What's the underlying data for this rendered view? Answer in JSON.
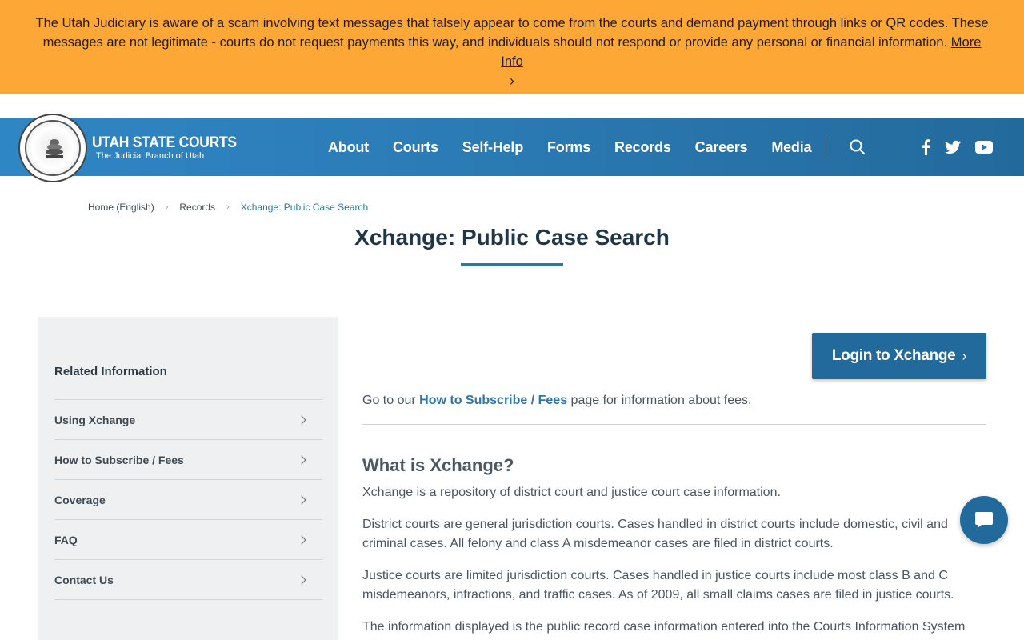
{
  "alert": {
    "message": "The Utah Judiciary is aware of a scam involving text messages that falsely appear to come from the courts and demand payment through links or QR codes. These messages are not legitimate - courts do not request payments this way, and individuals should not respond or provide any personal or financial information.",
    "link_label": "More Info",
    "chevron": "›",
    "background": "#fda836"
  },
  "header": {
    "brand_title": "UTAH STATE COURTS",
    "brand_subtitle": "The Judicial Branch of Utah",
    "nav": [
      "About",
      "Courts",
      "Self-Help",
      "Forms",
      "Records",
      "Careers",
      "Media"
    ],
    "icons": [
      "search-icon",
      "facebook-icon",
      "twitter-icon",
      "youtube-icon"
    ]
  },
  "breadcrumb": {
    "items": [
      "Home (English)",
      "Records",
      "Xchange: Public Case Search"
    ],
    "separator": "›"
  },
  "page": {
    "title": "Xchange: Public Case Search"
  },
  "sidebar": {
    "heading": "Related Information",
    "items": [
      "Using Xchange",
      "How to Subscribe / Fees",
      "Coverage",
      "FAQ",
      "Contact Us"
    ]
  },
  "main": {
    "login_button": "Login to Xchange",
    "login_chevron": "›",
    "intro_prefix": "Go to our ",
    "intro_link": "How to Subscribe / Fees",
    "intro_suffix": " page for information about fees.",
    "section_heading": "What is Xchange?",
    "paragraphs": [
      "Xchange is a repository of district court and justice court case information.",
      "District courts are general jurisdiction courts. Cases handled in district courts include domestic, civil and criminal cases. All felony and class A misdemeanor cases are filed in district courts.",
      "Justice courts are limited jurisdiction courts. Cases handled in justice courts include most class B and C misdemeanors, infractions, and traffic cases. As of 2009, all small claims cases are filed in justice courts.",
      "The information displayed is the public record case information entered into the Courts Information System"
    ]
  },
  "colors": {
    "primary": "#236a9c",
    "link": "#2b76ab",
    "alert": "#fda836"
  }
}
